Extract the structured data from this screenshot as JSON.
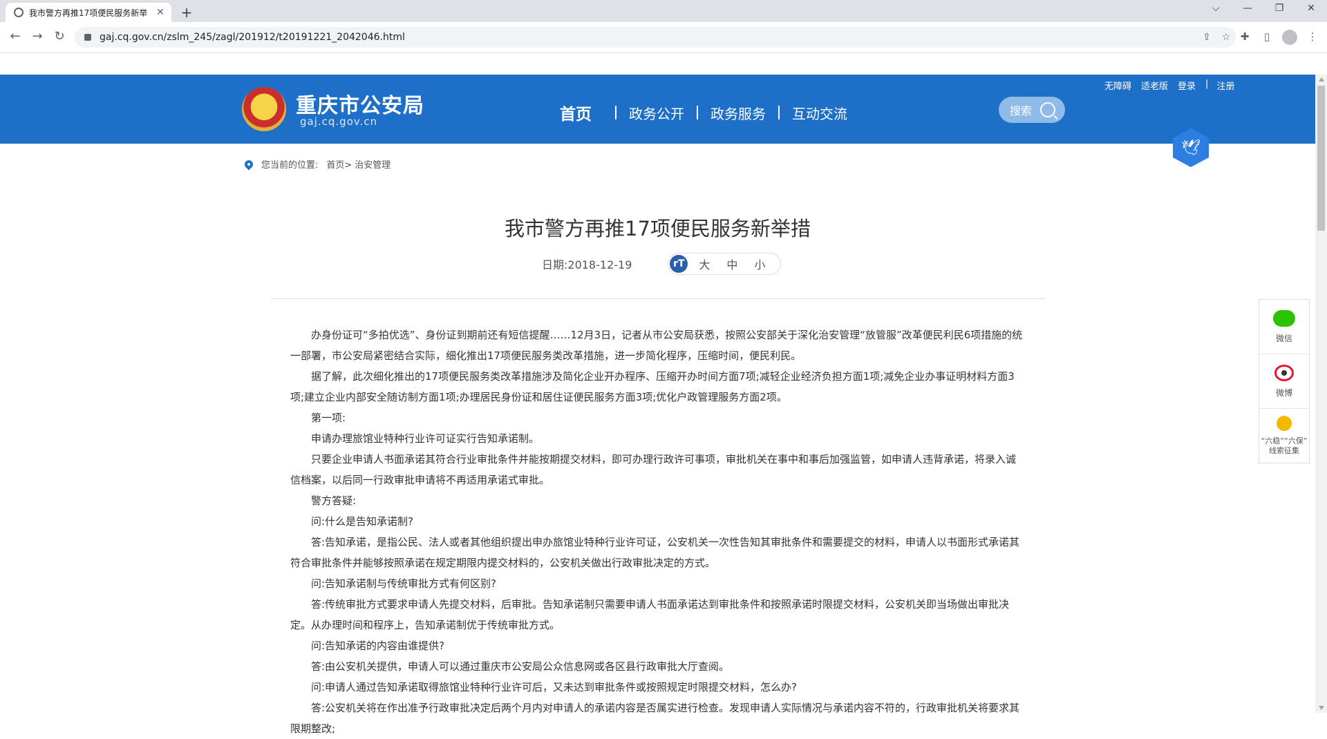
{
  "browser": {
    "tab_title": "我市警方再推17项便民服务新举",
    "close_glyph": "✕",
    "new_tab_glyph": "+",
    "url": "gaj.cq.gov.cn/zslm_245/zagl/201912/t20191221_2042046.html",
    "window_buttons": [
      "⌵",
      "—",
      "❐",
      "✕"
    ]
  },
  "header": {
    "site_name": "重庆市公安局",
    "site_domain": "gaj.cq.gov.cn",
    "nav": [
      "首页",
      "政务公开",
      "政务服务",
      "互动交流"
    ],
    "search_label": "搜索",
    "top_links": [
      "无障碍",
      "适老版",
      "登录",
      "|",
      "注册"
    ],
    "colors": {
      "header_bg": "#1e6fc8",
      "search_bg": "#8ebbe8"
    }
  },
  "breadcrumb": {
    "label": "您当前的位置:",
    "home": "首页>",
    "current": "治安管理"
  },
  "article": {
    "title": "我市警方再推17项便民服务新举措",
    "date": "日期:2018-12-19",
    "font_icon": "rT",
    "font_sizes": [
      "大",
      "中",
      "小"
    ],
    "paragraphs": [
      "办身份证可“多拍优选”、身份证到期前还有短信提醒……12月3日，记者从市公安局获悉，按照公安部关于深化治安管理“放管服”改革便民利民6项措施的统一部署，市公安局紧密结合实际，细化推出17项便民服务类改革措施，进一步简化程序，压缩时间，便民利民。",
      "据了解，此次细化推出的17项便民服务类改革措施涉及简化企业开办程序、压缩开办时间方面7项;减轻企业经济负担方面1项;减免企业办事证明材料方面3项;建立企业内部安全随访制方面1项;办理居民身份证和居住证便民服务方面3项;优化户政管理服务方面2项。",
      "第一项:",
      "申请办理旅馆业特种行业许可证实行告知承诺制。",
      "只要企业申请人书面承诺其符合行业审批条件并能按期提交材料，即可办理行政许可事项，审批机关在事中和事后加强监管，如申请人违背承诺，将录入诚信档案，以后同一行政审批申请将不再适用承诺式审批。",
      "警方答疑:",
      "问:什么是告知承诺制?",
      "答:告知承诺，是指公民、法人或者其他组织提出申办旅馆业特种行业许可证，公安机关一次性告知其审批条件和需要提交的材料，申请人以书面形式承诺其符合审批条件并能够按照承诺在规定期限内提交材料的，公安机关做出行政审批决定的方式。",
      "问:告知承诺制与传统审批方式有何区别?",
      "答:传统审批方式要求申请人先提交材料，后审批。告知承诺制只需要申请人书面承诺达到审批条件和按照承诺时限提交材料，公安机关即当场做出审批决定。从办理时间和程序上，告知承诺制优于传统审批方式。",
      "问:告知承诺的内容由谁提供?",
      "答:由公安机关提供，申请人可以通过重庆市公安局公众信息网或各区县行政审批大厅查阅。",
      "问:申请人通过告知承诺取得旅馆业特种行业许可后，又未达到审批条件或按照规定时限提交材料，怎么办?",
      "答:公安机关将在作出准予行政审批决定后两个月内对申请人的承诺内容是否属实进行检查。发现申请人实际情况与承诺内容不符的，行政审批机关将要求其限期整改;"
    ]
  },
  "share": {
    "wechat": "微信",
    "weibo": "微博",
    "clue_line1": "“六稳”“六保”",
    "clue_line2": "线索征集"
  }
}
